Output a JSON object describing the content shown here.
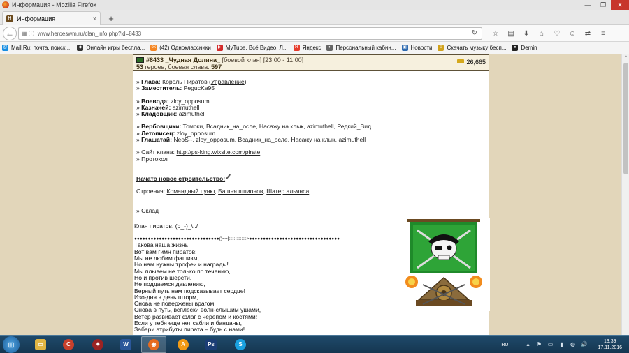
{
  "window": {
    "title": "Информация - Mozilla Firefox",
    "controls": [
      "—",
      "❐",
      "✕"
    ]
  },
  "tab": {
    "label": "Информация",
    "close": "×",
    "new_tab": "+"
  },
  "nav": {
    "url": "www.heroeswm.ru/clan_info.php?id=8433",
    "back": "←",
    "reload": "↻",
    "toolbar_icons": [
      "☆",
      "▤",
      "⬇",
      "⌂",
      "♡",
      "☺",
      "⇄",
      "≡"
    ]
  },
  "bookmarks": [
    {
      "label": "Mail.Ru: почта, поиск ...",
      "color": "#168de2"
    },
    {
      "label": "Онлайн игры беспла...",
      "color": "#333333"
    },
    {
      "label": "(42) Одноклассники",
      "color": "#f48420"
    },
    {
      "label": "MyTube. Всё Видео! Л...",
      "color": "#d32b2b"
    },
    {
      "label": "Яндекс",
      "color": "#e63c2c"
    },
    {
      "label": "Персональный кабин...",
      "color": "#666666"
    },
    {
      "label": "Новости",
      "color": "#2f6bb0"
    },
    {
      "label": "Скачать музыку бесп...",
      "color": "#d1a21c"
    },
    {
      "label": "Demin",
      "color": "#222222"
    }
  ],
  "clan": {
    "number": "#8433",
    "name": "_Чудная Долина_",
    "type_time": "[боевой клан] [23:00 - 11:00]",
    "heroes_count": "53",
    "heroes_text": "героев, боевая слава:",
    "glory": "597",
    "gold": "26,665"
  },
  "info": {
    "head_label": "Глава:",
    "head_value": "Король Пиратов",
    "manage_link": "Управление",
    "deputy_label": "Заместитель:",
    "deputy_value": "PegucKa95",
    "voevoda_label": "Воевода:",
    "voevoda_value": "zloy_opposum",
    "treasurer_label": "Казначей:",
    "treasurer_value": "azimuthell",
    "storekeeper_label": "Кладовщик:",
    "storekeeper_value": "azimuthell",
    "recruiters_label": "Вербовщики:",
    "recruiters_value": "Томоки, Всадник_на_осле, Насажу на клык, azimuthell, Редкий_Вид",
    "chronicler_label": "Летописец:",
    "chronicler_value": "zloy_opposum",
    "herald_label": "Глашатай:",
    "herald_value": "NeoS--, zloy_opposum, Всадник_на_осле, Насажу на клык, azimuthell",
    "site_label": "Сайт клана:",
    "site_url": "http://ps-king.wixsite.com/pirate",
    "protocol": "Протокол",
    "construction": "Начато новое строительство!",
    "buildings_label": "Строения:",
    "buildings": [
      "Командный пункт",
      "Башня шпионов",
      "Шатер альянса"
    ],
    "warehouse": "Склад",
    "bullet": "»"
  },
  "description": {
    "lines": [
      "Клан пиратов. (o_-)_\\../",
      "",
      "●●●●●●●●●●●●●●●●●●●●●●●●●●●●●●●()==[::::::::::::::>●●●●●●●●●●●●●●●●●●●●●●●●●●●●●●●●●",
      "Такова наша жизнь,",
      "Вот вам гимн пиратов:",
      "Мы не любим фашизм,",
      "Но нам нужны трофеи и награды!",
      "Мы плывем не только по течению,",
      "Но и против шерсти,",
      "Не поддаемся давлению,",
      "Верный путь нам подсказывает сердце!",
      "Изо-дня в день шторм,",
      "Снова не повержены врагом.",
      "Снова в путь, всплески волн-слышим ушами,",
      "Ветер развивает флаг с черепом и костями!",
      "Если у тебя еще нет сабли и банданы,",
      "Забери атрибуты пирата – будь с нами!"
    ]
  },
  "taskbar": {
    "start": "⊞",
    "apps": [
      {
        "name": "explorer",
        "color": "#e0b543",
        "glyph": "▭"
      },
      {
        "name": "ccleaner",
        "color": "#c8402c",
        "glyph": "C"
      },
      {
        "name": "game",
        "color": "#9c2323",
        "glyph": "✦"
      },
      {
        "name": "word",
        "color": "#2b579a",
        "glyph": "W"
      },
      {
        "name": "firefox",
        "color": "#e66b1f",
        "glyph": "◉"
      },
      {
        "name": "avast",
        "color": "#f29a14",
        "glyph": "A"
      },
      {
        "name": "photoshop",
        "color": "#1b3d75",
        "glyph": "Ps"
      },
      {
        "name": "skype",
        "color": "#1aa1e0",
        "glyph": "S"
      }
    ],
    "lang": "RU",
    "tray_icons": [
      "▴",
      "⚑",
      "▭",
      "▮",
      "◍",
      "🔊"
    ],
    "time": "13:39",
    "date": "17.11.2016"
  }
}
